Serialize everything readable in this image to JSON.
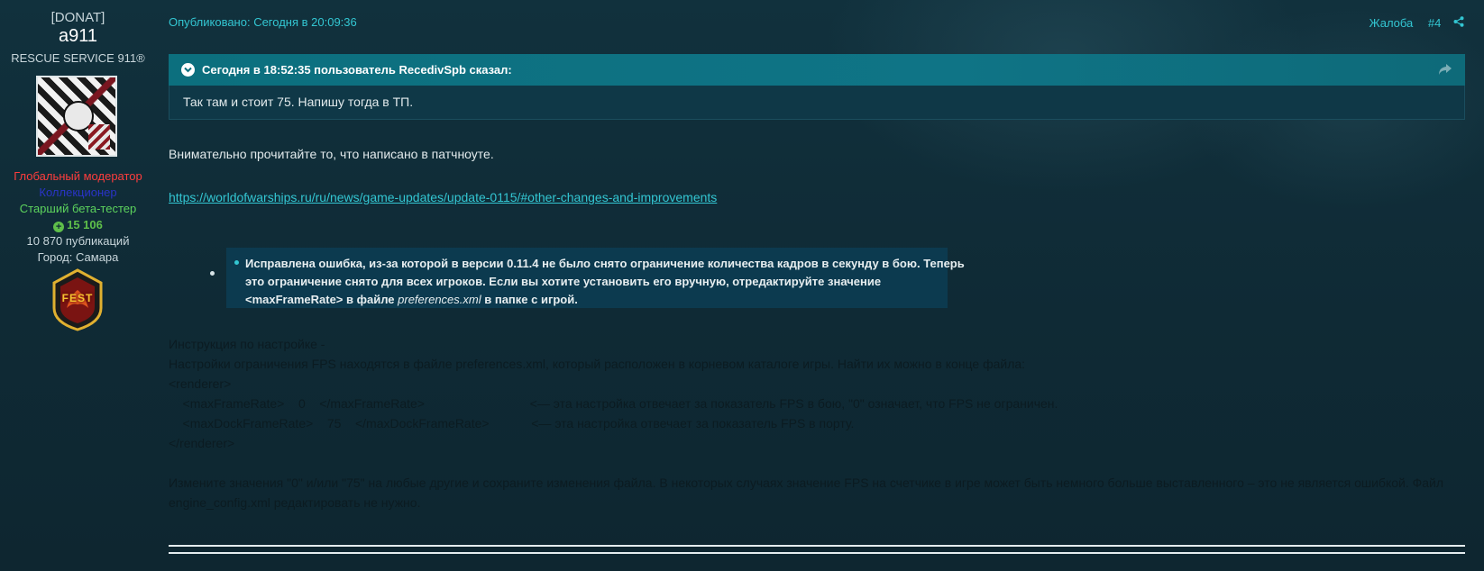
{
  "author": {
    "group_tag": "[DONAT]",
    "username": "a911",
    "clan": "RESCUE SERVICE 911®",
    "roles": {
      "moderator": "Глобальный модератор",
      "collector": "Коллекционер",
      "beta": "Старший бета-тестер"
    },
    "reputation": "15 106",
    "posts": "10 870 публикаций",
    "city": "Город: Самара",
    "badge_text": "FEST",
    "colors": {
      "moderator": "#ff3d3d",
      "collector": "#2a34c8",
      "beta": "#5dd35d",
      "reputation": "#5fbf4a"
    }
  },
  "post": {
    "published": "Опубликовано: Сегодня в 20:09:36",
    "report_label": "Жалоба",
    "post_number": "#4",
    "quote": {
      "cite": "Сегодня в 18:52:35 пользователь RecedivSpb сказал:",
      "body": "Так там и стоит 75. Напишу тогда в ТП."
    },
    "paragraph1": "Внимательно прочитайте то, что написано в патчноуте.",
    "link": "https://worldofwarships.ru/ru/news/game-updates/update-0115/#other-changes-and-improvements",
    "patch_note": {
      "line1": "Исправлена ошибка, из-за которой в версии 0.11.4 не было снято ограничение количества кадров в секунду в бою. Теперь",
      "line2": "это ограничение снято для всех игроков. Если вы хотите установить его вручную, отредактируйте значение",
      "line3_before": "<maxFrameRate> в файле ",
      "line3_file": "preferences.xml",
      "line3_after": " в папке с игрой."
    },
    "instructions": {
      "title": "Инструкция по настройке -",
      "line1": "Настройки ограничения FPS находятся в файле preferences.xml, который расположен в корневом каталоге игры. Найти их можно в конце файла:",
      "line2": "<renderer>",
      "line3": "    <maxFrameRate>    0    </maxFrameRate>                              <— эта настройка отвечает за показатель FPS в бою, \"0\" означает, что FPS не ограничен.",
      "line4": "    <maxDockFrameRate>    75    </maxDockFrameRate>            <— эта настройка отвечает за показатель FPS в порту.",
      "line5": "</renderer>",
      "final1": "Измените значения \"0\" и/или \"75\" на любые другие и сохраните изменения файла. В некоторых случаях значение FPS на счетчике в игре может быть немного больше выставленного – это не является ошибкой. Файл",
      "final2": "engine_config.xml редактировать не нужно."
    }
  },
  "colors": {
    "accent": "#33c6d2",
    "quote_header": "#0c6f7e",
    "background": "#0f2a35"
  },
  "icons": {
    "share": "share-icon",
    "quote_toggle": "chevron-down-icon",
    "quote_jump": "reply-arrow-icon"
  }
}
